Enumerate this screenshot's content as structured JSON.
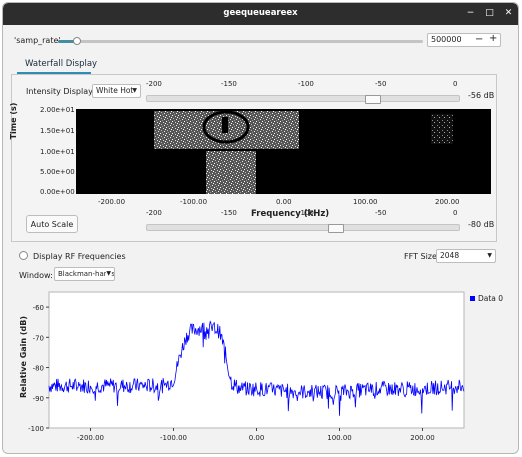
{
  "window": {
    "title": "geequeueareex"
  },
  "controls": {
    "samp_rate_label": "'samp_rate'",
    "samp_rate_value": "500000",
    "minus_label": "−",
    "plus_label": "+"
  },
  "tabs": [
    {
      "label": "Waterfall Display"
    }
  ],
  "waterfall": {
    "intensity_label": "Intensity Display:",
    "intensity_value": "White Hot",
    "top_range_ticks": [
      "-200",
      "-150",
      "-100",
      "-50",
      "0"
    ],
    "top_range_value": "-56 dB",
    "bottom_range_ticks": [
      "-200",
      "-150",
      "-100",
      "-50",
      "0"
    ],
    "bottom_range_value": "-80 dB",
    "y_ticks": [
      "2.00e+01",
      "1.50e+01",
      "1.00e+01",
      "5.00e+00",
      "0.00e+00"
    ],
    "y_label": "Time (s)",
    "x_ticks": [
      "-200.00",
      "-100.00",
      "0.00",
      "100.00",
      "200.00"
    ],
    "x_label": "Frequency (kHz)",
    "auto_scale_label": "Auto Scale"
  },
  "options": {
    "display_rf_label": "Display RF Frequencies",
    "fft_size_label": "FFT Size:",
    "fft_size_value": "2048",
    "window_label": "Window:",
    "window_value": "Blackman-harris"
  },
  "colors": {
    "accent": "#2b8fb5",
    "slider_fill": "#3f8f9f",
    "trace": "#0000ff",
    "titlebar": "#2d2d2d"
  },
  "chart_data": {
    "type": "line",
    "title": "",
    "xlabel": "",
    "ylabel": "Relative Gain (dB)",
    "xlim": [
      -250,
      250
    ],
    "ylim": [
      -100,
      -55
    ],
    "x_ticks": [
      "-200.00",
      "-100.00",
      "0.00",
      "100.00",
      "200.00"
    ],
    "y_ticks": [
      "-60",
      "-70",
      "-80",
      "-90",
      "-100"
    ],
    "legend": "top-right",
    "series": [
      {
        "name": "Data 0",
        "color": "#0000ff",
        "x": [
          -250,
          -200,
          -150,
          -110,
          -100,
          -95,
          -90,
          -85,
          -80,
          -70,
          -60,
          -50,
          -45,
          -40,
          -35,
          -30,
          -20,
          0,
          50,
          100,
          150,
          200,
          250
        ],
        "y": [
          -86,
          -86,
          -86,
          -86,
          -84,
          -79,
          -74,
          -70,
          -68,
          -67,
          -67,
          -67,
          -68,
          -72,
          -79,
          -85,
          -87,
          -87,
          -88,
          -88,
          -87,
          -87,
          -86
        ]
      }
    ]
  }
}
